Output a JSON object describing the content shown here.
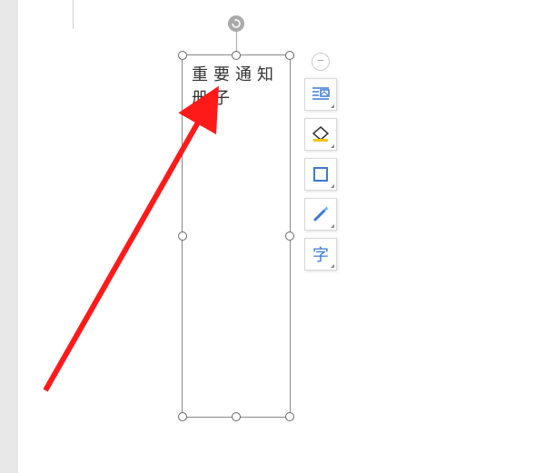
{
  "textbox": {
    "content": "重要通知册子"
  },
  "toolbar": {
    "collapse_symbol": "−",
    "typography_label": "字"
  },
  "icons": {
    "rotate": "rotate",
    "layout": "layout",
    "fill": "fill",
    "outline": "outline",
    "effects": "effects",
    "typography": "typography"
  },
  "colors": {
    "arrow": "#ff1a1a",
    "accent_blue": "#3a7bd5",
    "accent_yellow": "#f5c518"
  }
}
